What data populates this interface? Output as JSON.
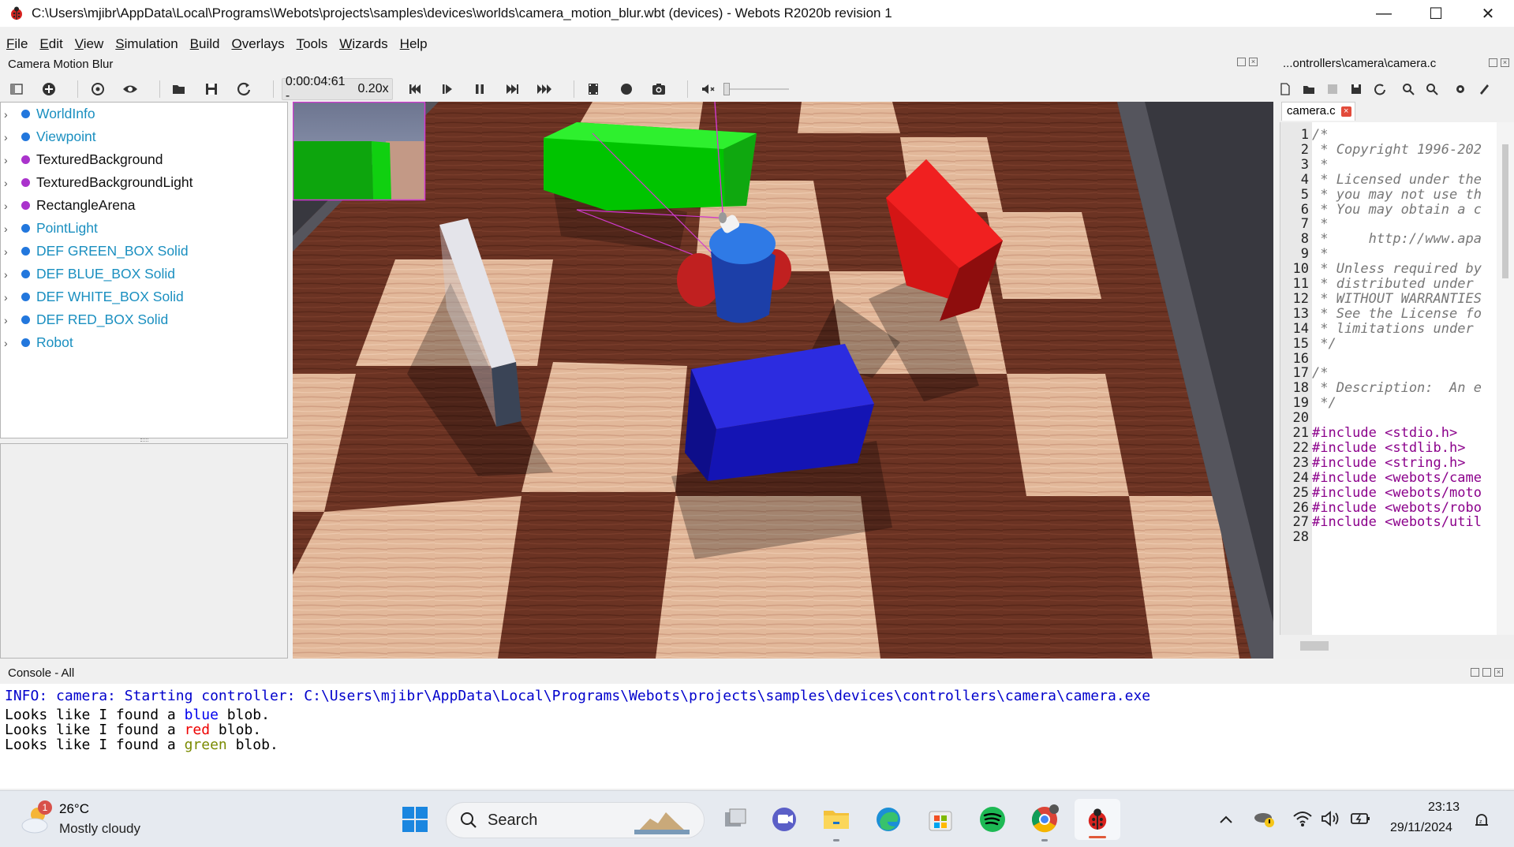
{
  "window": {
    "title": "C:\\Users\\mjibr\\AppData\\Local\\Programs\\Webots\\projects\\samples\\devices\\worlds\\camera_motion_blur.wbt (devices) - Webots R2020b revision 1",
    "minimize": "—",
    "maximize": "☐",
    "close": "✕"
  },
  "menu": [
    {
      "first": "F",
      "rest": "ile"
    },
    {
      "first": "E",
      "rest": "dit"
    },
    {
      "first": "V",
      "rest": "iew"
    },
    {
      "first": "S",
      "rest": "imulation"
    },
    {
      "first": "B",
      "rest": "uild"
    },
    {
      "first": "O",
      "rest": "verlays"
    },
    {
      "first": "T",
      "rest": "ools"
    },
    {
      "first": "W",
      "rest": "izards"
    },
    {
      "first": "H",
      "rest": "elp"
    }
  ],
  "scene_panel": {
    "title": "Camera Motion Blur"
  },
  "toolbar": {
    "time": "0:00:04:61 -",
    "speed": "0.20x"
  },
  "scene_tree": [
    {
      "label": "WorldInfo",
      "color": "#1a8fc0",
      "dot": "#2277dd"
    },
    {
      "label": "Viewpoint",
      "color": "#1a8fc0",
      "dot": "#2277dd"
    },
    {
      "label": "TexturedBackground",
      "color": "#111111",
      "dot": "#aa33cc"
    },
    {
      "label": "TexturedBackgroundLight",
      "color": "#111111",
      "dot": "#aa33cc"
    },
    {
      "label": "RectangleArena",
      "color": "#111111",
      "dot": "#aa33cc"
    },
    {
      "label": "PointLight",
      "color": "#1a8fc0",
      "dot": "#2277dd"
    },
    {
      "label": "DEF GREEN_BOX Solid",
      "color": "#1a8fc0",
      "dot": "#2277dd"
    },
    {
      "label": "DEF BLUE_BOX Solid",
      "color": "#1a8fc0",
      "dot": "#2277dd"
    },
    {
      "label": "DEF WHITE_BOX Solid",
      "color": "#1a8fc0",
      "dot": "#2277dd"
    },
    {
      "label": "DEF RED_BOX Solid",
      "color": "#1a8fc0",
      "dot": "#2277dd"
    },
    {
      "label": "Robot",
      "color": "#1a8fc0",
      "dot": "#2277dd"
    }
  ],
  "editor": {
    "path": "...ontrollers\\camera\\camera.c",
    "tab": "camera.c",
    "tab_close": "×",
    "lines": [
      {
        "n": "1",
        "t": "/*",
        "k": "cmt"
      },
      {
        "n": "2",
        "t": " * Copyright 1996-202",
        "k": "cmt"
      },
      {
        "n": "3",
        "t": " *",
        "k": "cmt"
      },
      {
        "n": "4",
        "t": " * Licensed under the",
        "k": "cmt"
      },
      {
        "n": "5",
        "t": " * you may not use th",
        "k": "cmt"
      },
      {
        "n": "6",
        "t": " * You may obtain a c",
        "k": "cmt"
      },
      {
        "n": "7",
        "t": " *",
        "k": "cmt"
      },
      {
        "n": "8",
        "t": " *     http://www.apa",
        "k": "cmt"
      },
      {
        "n": "9",
        "t": " *",
        "k": "cmt"
      },
      {
        "n": "10",
        "t": " * Unless required by",
        "k": "cmt"
      },
      {
        "n": "11",
        "t": " * distributed under",
        "k": "cmt"
      },
      {
        "n": "12",
        "t": " * WITHOUT WARRANTIES",
        "k": "cmt"
      },
      {
        "n": "13",
        "t": " * See the License fo",
        "k": "cmt"
      },
      {
        "n": "14",
        "t": " * limitations under",
        "k": "cmt"
      },
      {
        "n": "15",
        "t": " */",
        "k": "cmt"
      },
      {
        "n": "16",
        "t": "",
        "k": "cmt"
      },
      {
        "n": "17",
        "t": "/*",
        "k": "cmt"
      },
      {
        "n": "18",
        "t": " * Description:  An e",
        "k": "cmt"
      },
      {
        "n": "19",
        "t": " */",
        "k": "cmt"
      },
      {
        "n": "20",
        "t": "",
        "k": "cmt"
      },
      {
        "n": "21",
        "t": "#include <stdio.h>",
        "k": "pp"
      },
      {
        "n": "22",
        "t": "#include <stdlib.h>",
        "k": "pp"
      },
      {
        "n": "23",
        "t": "#include <string.h>",
        "k": "pp"
      },
      {
        "n": "24",
        "t": "#include <webots/came",
        "k": "pp"
      },
      {
        "n": "25",
        "t": "#include <webots/moto",
        "k": "pp"
      },
      {
        "n": "26",
        "t": "#include <webots/robo",
        "k": "pp"
      },
      {
        "n": "27",
        "t": "#include <webots/util",
        "k": "pp"
      },
      {
        "n": "28",
        "t": "",
        "k": "pp"
      }
    ]
  },
  "console": {
    "title": "Console - All",
    "info": "INFO: camera: Starting controller: C:\\Users\\mjibr\\AppData\\Local\\Programs\\Webots\\projects\\samples\\devices\\controllers\\camera\\camera.exe",
    "prefix": "Looks like I found a ",
    "suffix": " blob.",
    "blobs": [
      {
        "word": "blue",
        "color": "#0000ee"
      },
      {
        "word": "red",
        "color": "#ee0000"
      },
      {
        "word": "green",
        "color": "#7a8a00"
      }
    ]
  },
  "taskbar": {
    "weather_temp": "26°C",
    "weather_desc": "Mostly cloudy",
    "weather_badge": "1",
    "search": "Search",
    "time": "23:13",
    "date": "29/11/2024"
  }
}
